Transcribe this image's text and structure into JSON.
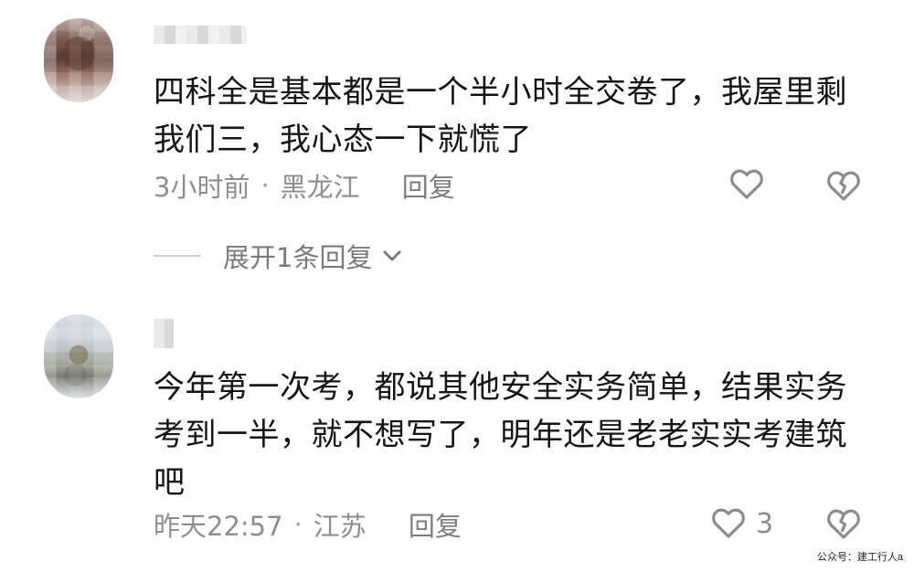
{
  "comments": [
    {
      "text": "四科全是基本都是一个半小时全交卷了，我屋里剩\n我们三，我心态一下就慌了",
      "time": "3小时前",
      "dot": "·",
      "location": "黑龙江",
      "reply": "回复",
      "likes": "",
      "expand_text": "展开1条回复"
    },
    {
      "text": "今年第一次考，都说其他安全实务简单，结果实务\n考到一半，就不想写了，明年还是老老实实考建筑\n吧",
      "time": "昨天22:57",
      "dot": "·",
      "location": "江苏",
      "reply": "回复",
      "likes": "3"
    }
  ],
  "watermark": "公众号：建工行人a",
  "icons": {
    "like": "heart-outline-icon",
    "dislike": "broken-heart-icon",
    "expand": "chevron-down-icon"
  },
  "colors": {
    "text": "#151515",
    "meta": "#8e8e8e",
    "icon": "#8d8d8d",
    "divider": "#d0d0d0",
    "background": "#ffffff"
  }
}
